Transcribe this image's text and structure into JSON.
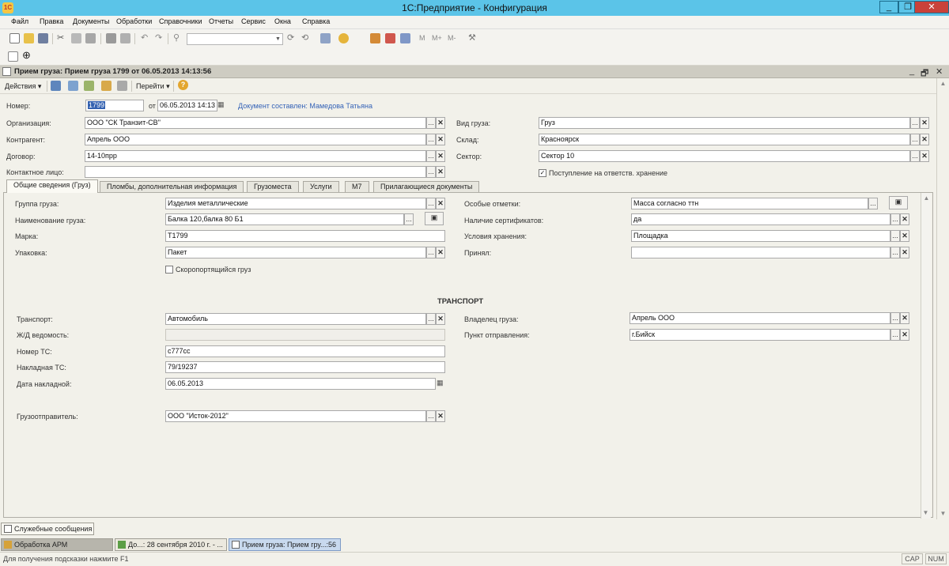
{
  "app": {
    "title": "1С:Предприятие - Конфигурация",
    "icon_text": "1С",
    "window_controls": {
      "minimize": "_",
      "maximize": "❐",
      "close": "✕"
    }
  },
  "menu": [
    "Файл",
    "Правка",
    "Документы",
    "Обработки",
    "Справочники",
    "Отчеты",
    "Сервис",
    "Окна",
    "Справка"
  ],
  "document": {
    "title": "Прием груза: Прием груза 1799 от 06.05.2013 14:13:56",
    "controls": {
      "minimize": "_",
      "restore": "🗗",
      "close": "✕"
    },
    "toolbar": {
      "actions": "Действия ▾",
      "goto": "Перейти ▾",
      "help": "?"
    },
    "header": {
      "number_label": "Номер:",
      "number": "1799",
      "date_label": "от",
      "date": "06.05.2013 14:13",
      "author": "Документ составлен: Мамедова Татьяна",
      "org_label": "Организация:",
      "org": "ООО \"СК Транзит-СВ\"",
      "counterparty_label": "Контрагент:",
      "counterparty": "Апрель ООО",
      "contract_label": "Договор:",
      "contract": "14-10прр",
      "contact_label": "Контактное лицо:",
      "contact": "",
      "cargo_type_label": "Вид груза:",
      "cargo_type": "Груз",
      "warehouse_label": "Склад:",
      "warehouse": "Красноярск",
      "sector_label": "Сектор:",
      "sector": "Сектор 10",
      "custody_label": "Поступление на ответств. хранение",
      "custody_checked": true
    },
    "tabs": [
      {
        "label": "Общие сведения (Груз)",
        "active": true
      },
      {
        "label": "Пломбы, дополнительная информация",
        "active": false
      },
      {
        "label": "Грузоместа",
        "active": false
      },
      {
        "label": "Услуги",
        "active": false
      },
      {
        "label": "М7",
        "active": false
      },
      {
        "label": "Прилагающиеся документы",
        "active": false
      }
    ],
    "general": {
      "group_label": "Группа груза:",
      "group": "Изделия металлические",
      "name_label": "Наименование груза:",
      "name": "Балка 120,балка 80 Б1",
      "mark_label": "Марка:",
      "mark": "Т1799",
      "packing_label": "Упаковка:",
      "packing": "Пакет",
      "perishable_label": "Скоропортящийся груз",
      "perishable_checked": false,
      "notes_label": "Особые отметки:",
      "notes": "Масса согласно ттн",
      "certs_label": "Наличие сертификатов:",
      "certs": "да",
      "storage_label": "Условия хранения:",
      "storage": "Площадка",
      "accepted_label": "Принял:",
      "accepted": ""
    },
    "transport": {
      "section_title": "ТРАНСПОРТ",
      "transport_label": "Транспорт:",
      "transport": "Автомобиль",
      "rail_label": "Ж/Д ведомость:",
      "rail": "",
      "vehicle_label": "Номер ТС:",
      "vehicle": "с777сс",
      "waybill_label": "Накладная ТС:",
      "waybill": "79/19237",
      "waybill_date_label": "Дата накладной:",
      "waybill_date": "06.05.2013",
      "owner_label": "Владелец груза:",
      "owner": "Апрель ООО",
      "departure_label": "Пункт отправления:",
      "departure": "г.Бийск",
      "shipper_label": "Грузоотправитель:",
      "shipper": "ООО \"Исток-2012\""
    }
  },
  "bottom": {
    "messages": "Служебные сообщения",
    "tasks": [
      "Обработка  АРМ",
      "До...: 28 сентября 2010 г. - ...",
      "Прием груза: Прием гру...:56"
    ],
    "status_hint": "Для получения подсказки нажмите F1",
    "cap": "CAP",
    "num": "NUM"
  },
  "colors": {
    "titlebar": "#5bc4e8",
    "selection": "#3361b0",
    "link": "#3563b7"
  }
}
